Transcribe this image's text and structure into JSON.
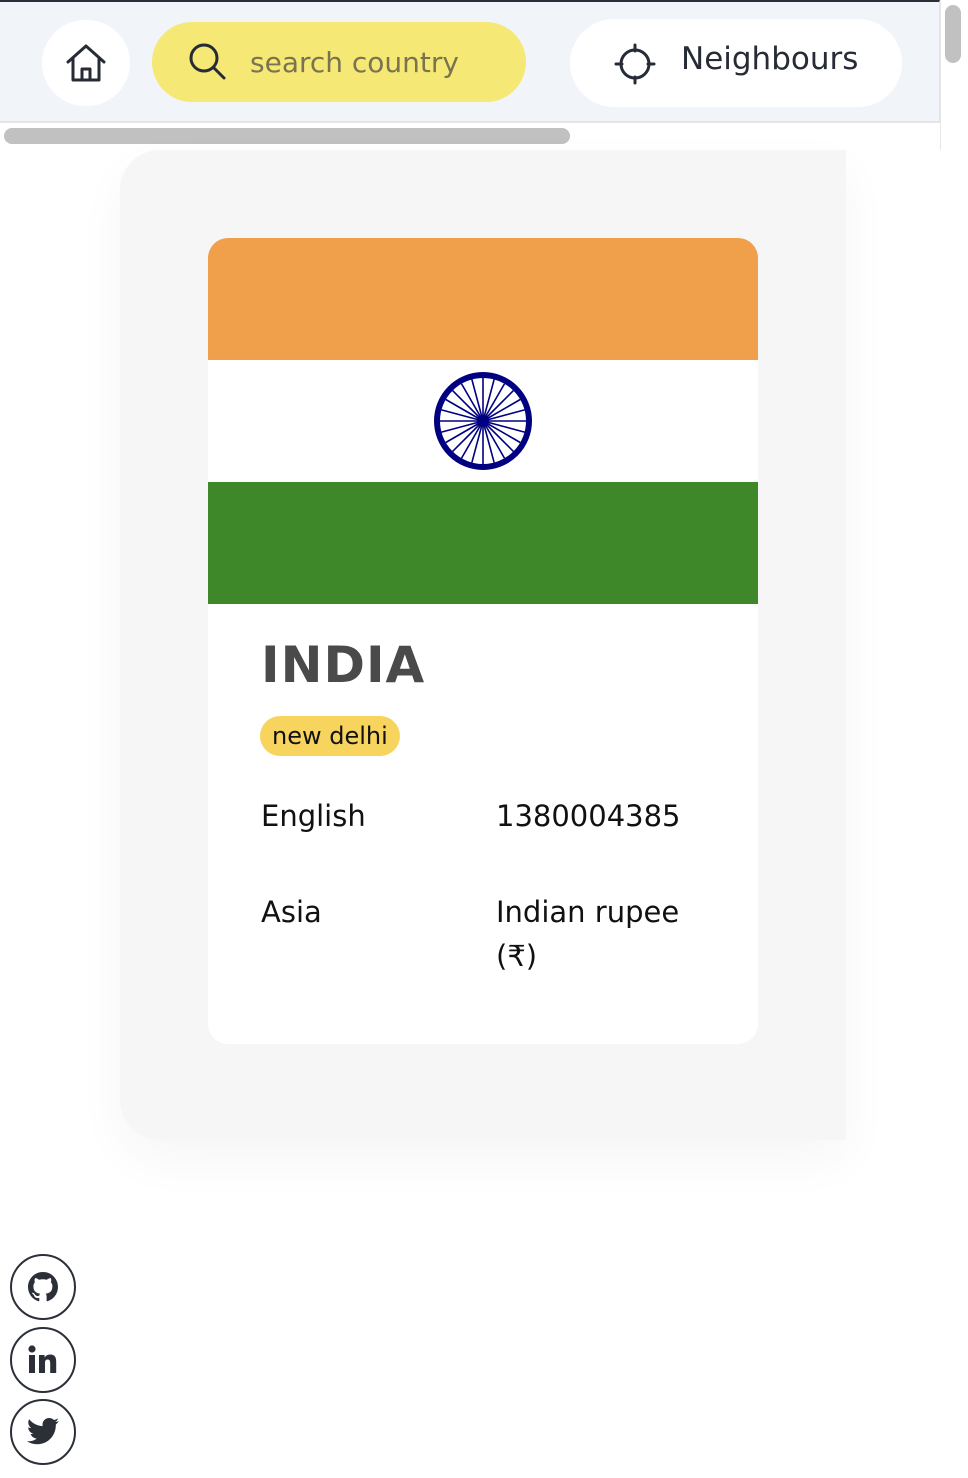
{
  "nav": {
    "home_icon": "home-icon",
    "search": {
      "icon": "search-icon",
      "placeholder": "search country",
      "value": ""
    },
    "neighbours": {
      "icon": "crosshair-icon",
      "label": "Neighbours"
    }
  },
  "country": {
    "name": "INDIA",
    "capital": "new delhi",
    "language": "English",
    "population": "1380004385",
    "region": "Asia",
    "currency": "Indian rupee (₹)",
    "flag": {
      "description_colors": {
        "saffron": "#f0a04b",
        "white": "#ffffff",
        "green": "#3f8829",
        "chakra": "#000080"
      }
    }
  },
  "social": [
    {
      "icon": "github-icon"
    },
    {
      "icon": "linkedin-icon"
    },
    {
      "icon": "twitter-icon"
    }
  ],
  "colors": {
    "accent_yellow": "#f5e875",
    "badge_yellow": "#f7d45d",
    "nav_background": "#f1f4f9"
  }
}
